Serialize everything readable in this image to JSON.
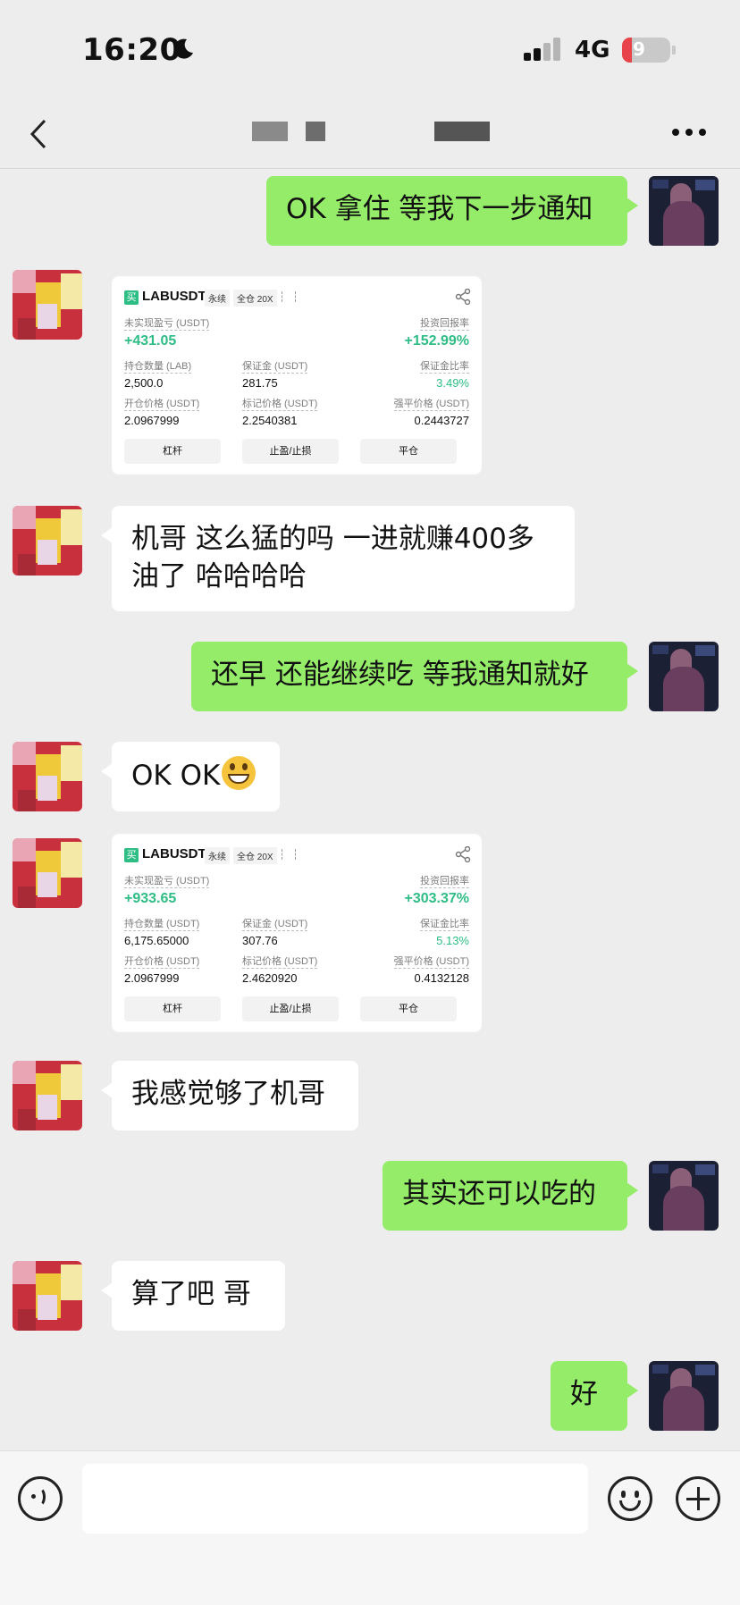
{
  "status": {
    "time": "16:20",
    "network": "4G",
    "battery": "9"
  },
  "nav": {
    "more_label": "···"
  },
  "messages": {
    "m1": "OK 拿住 等我下一步通知",
    "m3_line1": "机哥 这么猛的吗 一进就赚400多",
    "m3_line2": "油了 哈哈哈哈",
    "m4": "还早 还能继续吃 等我通知就好",
    "m5": "OK OK",
    "m7": "我感觉够了机哥",
    "m8": "其实还可以吃的",
    "m9": "算了吧 哥",
    "m10": "好"
  },
  "card_labels": {
    "buy": "买",
    "perp": "永续",
    "cross": "全仓 20X",
    "unrealized": "未实现盈亏 (USDT)",
    "roi": "投资回报率",
    "margin": "保证金 (USDT)",
    "margin_ratio": "保证金比率",
    "entry": "开仓价格 (USDT)",
    "mark": "标记价格 (USDT)",
    "liq": "强平价格 (USDT)",
    "btn_leverage": "杠杆",
    "btn_tpsl": "止盈/止损",
    "btn_close": "平仓"
  },
  "card1": {
    "symbol": "LABUSDT",
    "size_label": "持仓数量 (LAB)",
    "pnl": "+431.05",
    "roi": "+152.99%",
    "size": "2,500.0",
    "margin": "281.75",
    "margin_ratio": "3.49%",
    "entry": "2.0967999",
    "mark": "2.2540381",
    "liq": "0.2443727"
  },
  "card2": {
    "symbol": "LABUSDT",
    "size_label": "持仓数量 (USDT)",
    "pnl": "+933.65",
    "roi": "+303.37%",
    "size": "6,175.65000",
    "margin": "307.76",
    "margin_ratio": "5.13%",
    "entry": "2.0967999",
    "mark": "2.4620920",
    "liq": "0.4132128"
  },
  "colors": {
    "sent_bubble": "#95ec69",
    "received_bubble": "#ffffff",
    "profit": "#2ebd85",
    "background": "#ededed"
  },
  "icons": {
    "back": "chevron-left-icon",
    "more": "ellipsis-icon",
    "voice": "voice-icon",
    "emoji": "emoji-icon",
    "plus": "plus-icon",
    "share": "share-icon",
    "grin": "grinning-emoji"
  }
}
